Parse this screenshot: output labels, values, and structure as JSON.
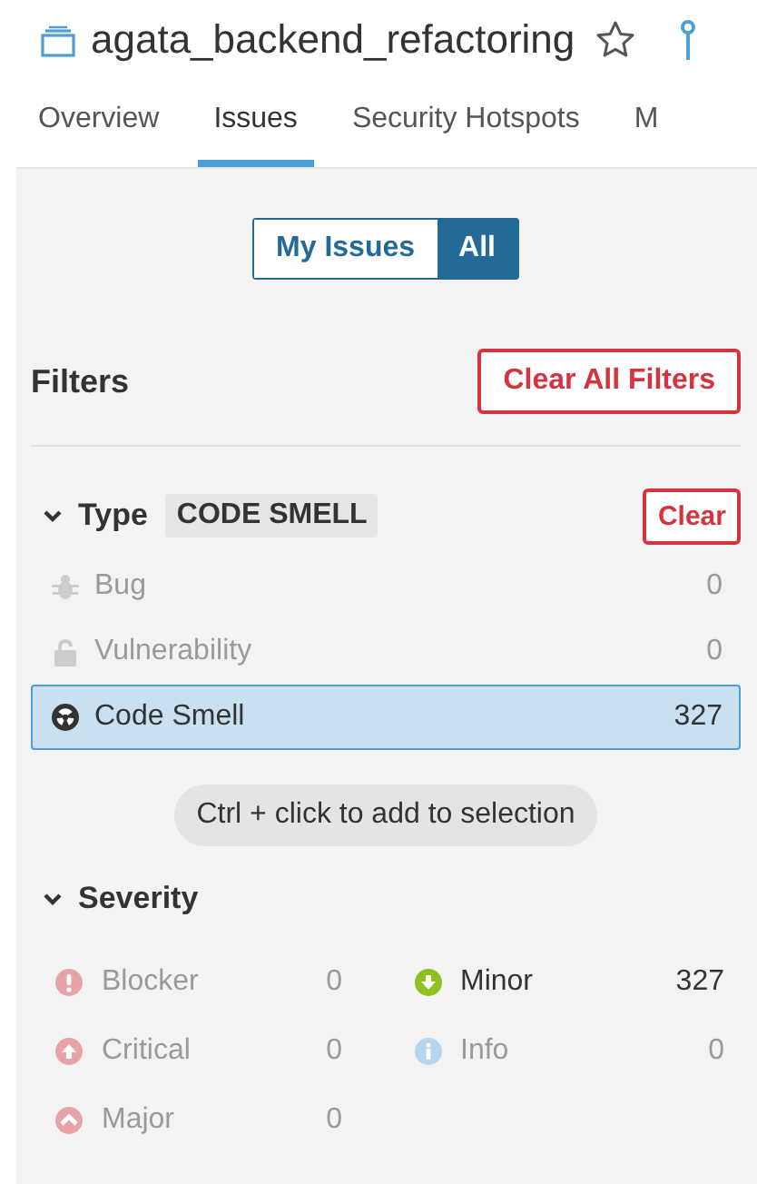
{
  "header": {
    "title": "agata_backend_refactoring",
    "starred": false
  },
  "tabs": [
    {
      "label": "Overview",
      "selected": false
    },
    {
      "label": "Issues",
      "selected": true
    },
    {
      "label": "Security Hotspots",
      "selected": false
    },
    {
      "label": "M",
      "selected": false
    }
  ],
  "scope_toggle": [
    {
      "label": "My Issues",
      "selected": false
    },
    {
      "label": "All",
      "selected": true
    }
  ],
  "filters": {
    "title": "Filters",
    "clear_all": "Clear All Filters"
  },
  "type_facet": {
    "title": "Type",
    "expanded": true,
    "value_badge": "CODE SMELL",
    "clear": "Clear",
    "items": [
      {
        "kind": "bug",
        "label": "Bug",
        "count": "0",
        "disabled": true,
        "selected": false
      },
      {
        "kind": "vulnerability",
        "label": "Vulnerability",
        "count": "0",
        "disabled": true,
        "selected": false
      },
      {
        "kind": "code_smell",
        "label": "Code Smell",
        "count": "327",
        "disabled": false,
        "selected": true
      }
    ],
    "hint": "Ctrl + click to add to selection"
  },
  "severity_facet": {
    "title": "Severity",
    "expanded": true,
    "items": [
      {
        "kind": "blocker",
        "label": "Blocker",
        "count": "0",
        "disabled": true,
        "color": "#e8a3a8"
      },
      {
        "kind": "minor",
        "label": "Minor",
        "count": "327",
        "disabled": false,
        "color": "#8dc21f"
      },
      {
        "kind": "critical",
        "label": "Critical",
        "count": "0",
        "disabled": true,
        "color": "#e8a3a8"
      },
      {
        "kind": "info",
        "label": "Info",
        "count": "0",
        "disabled": true,
        "color": "#b6d6ee"
      },
      {
        "kind": "major",
        "label": "Major",
        "count": "0",
        "disabled": true,
        "color": "#e8a3a8"
      }
    ]
  }
}
